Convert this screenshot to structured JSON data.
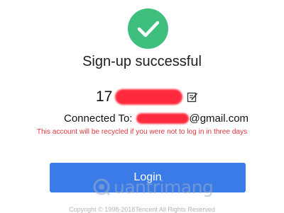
{
  "icons": {
    "success": "check-circle-icon",
    "edit": "edit-icon"
  },
  "title": "Sign-up successful",
  "account": {
    "prefix": "17"
  },
  "connected": {
    "label": "Connected To:",
    "email_domain": "@gmail.com"
  },
  "warning": "This account will be recycled if you were not to log in in three days",
  "login_button": "Login",
  "watermark": "uantrimang",
  "copyright": "Copyright © 1998-2018Tencent All Rights Reserved",
  "colors": {
    "success": "#3fbf7e",
    "primary": "#3b7be8",
    "warning": "#e0353a",
    "redaction": "#ff2a3d"
  }
}
